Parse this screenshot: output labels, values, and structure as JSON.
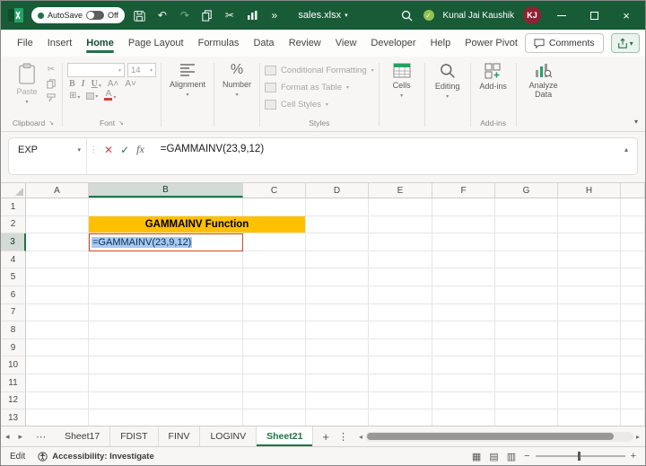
{
  "titlebar": {
    "autosave_label": "AutoSave",
    "autosave_state": "Off",
    "filename": "sales.xlsx",
    "user_name": "Kunal Jai Kaushik",
    "user_initials": "KJ"
  },
  "menubar": {
    "tabs": [
      "File",
      "Insert",
      "Home",
      "Page Layout",
      "Formulas",
      "Data",
      "Review",
      "View",
      "Developer",
      "Help",
      "Power Pivot"
    ],
    "active_tab": "Home",
    "comments_label": "Comments"
  },
  "ribbon": {
    "clipboard": {
      "paste_label": "Paste",
      "group_label": "Clipboard"
    },
    "font": {
      "size": "14",
      "bold": "B",
      "italic": "I",
      "underline": "U",
      "group_label": "Font"
    },
    "alignment": {
      "label": "Alignment"
    },
    "number": {
      "label": "Number",
      "percent_glyph": "%"
    },
    "styles": {
      "items": [
        "Conditional Formatting",
        "Format as Table",
        "Cell Styles"
      ],
      "group_label": "Styles"
    },
    "cells": {
      "label": "Cells"
    },
    "editing": {
      "label": "Editing"
    },
    "addins": {
      "button_label": "Add-ins",
      "group_label": "Add-ins"
    },
    "analyze": {
      "label": "Analyze Data"
    }
  },
  "formula_bar": {
    "name_box": "EXP",
    "fx_label": "fx",
    "formula": "=GAMMAINV(23,9,12)"
  },
  "grid": {
    "columns": [
      "A",
      "B",
      "C",
      "D",
      "E",
      "F",
      "G",
      "H"
    ],
    "rows": [
      "1",
      "2",
      "3",
      "4",
      "5",
      "6",
      "7",
      "8",
      "9",
      "10",
      "11",
      "12",
      "13"
    ],
    "selected_column": "B",
    "selected_row": "3",
    "title_cell": {
      "address": "B2",
      "text": "GAMMAINV Function",
      "bg": "#FFC000"
    },
    "formula_cell": {
      "address": "B3",
      "text": "=GAMMAINV(23,9,12)"
    }
  },
  "sheet_bar": {
    "tabs": [
      "Sheet17",
      "FDIST",
      "FINV",
      "LOGINV",
      "Sheet21"
    ],
    "active": "Sheet21"
  },
  "status_bar": {
    "mode": "Edit",
    "accessibility": "Accessibility: Investigate"
  },
  "colors": {
    "titlebar_green": "#185C37",
    "accent_green": "#217346",
    "title_cell_yellow": "#FFC000",
    "active_cell_border_red": "#D24726",
    "selection_blue": "#A9C8F1"
  }
}
